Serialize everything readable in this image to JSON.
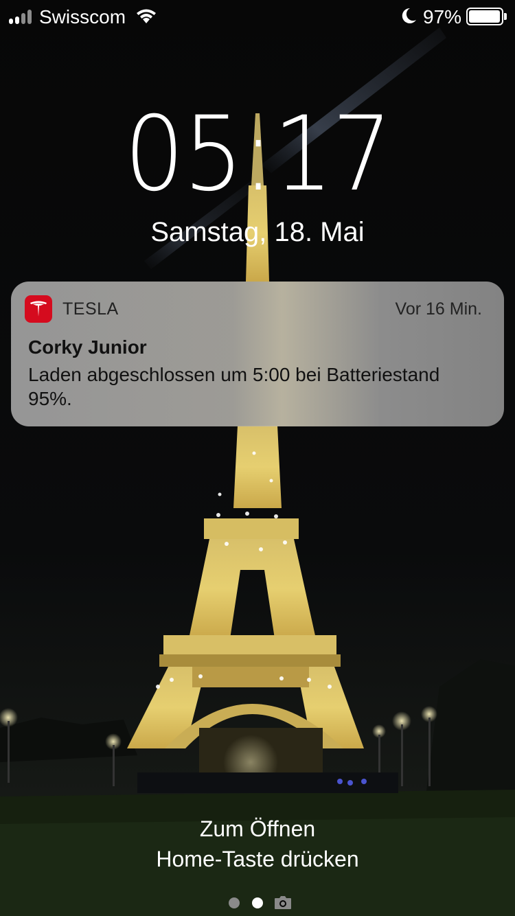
{
  "status_bar": {
    "carrier": "Swisscom",
    "battery_percent_text": "97%",
    "battery_level": 0.97
  },
  "lock": {
    "time": "05:17",
    "date": "Samstag, 18. Mai"
  },
  "notification": {
    "app_name": "TESLA",
    "time_ago": "Vor 16 Min.",
    "title": "Corky Junior",
    "body": "Laden abgeschlossen um 5:00 bei Batteriestand 95%.",
    "icon": "tesla-logo-icon",
    "icon_color": "#d50b1e"
  },
  "hint": {
    "line1": "Zum Öffnen",
    "line2": "Home-Taste drücken"
  },
  "page_indicator": {
    "pages": 2,
    "current": 2,
    "camera_icon": "camera-icon"
  }
}
